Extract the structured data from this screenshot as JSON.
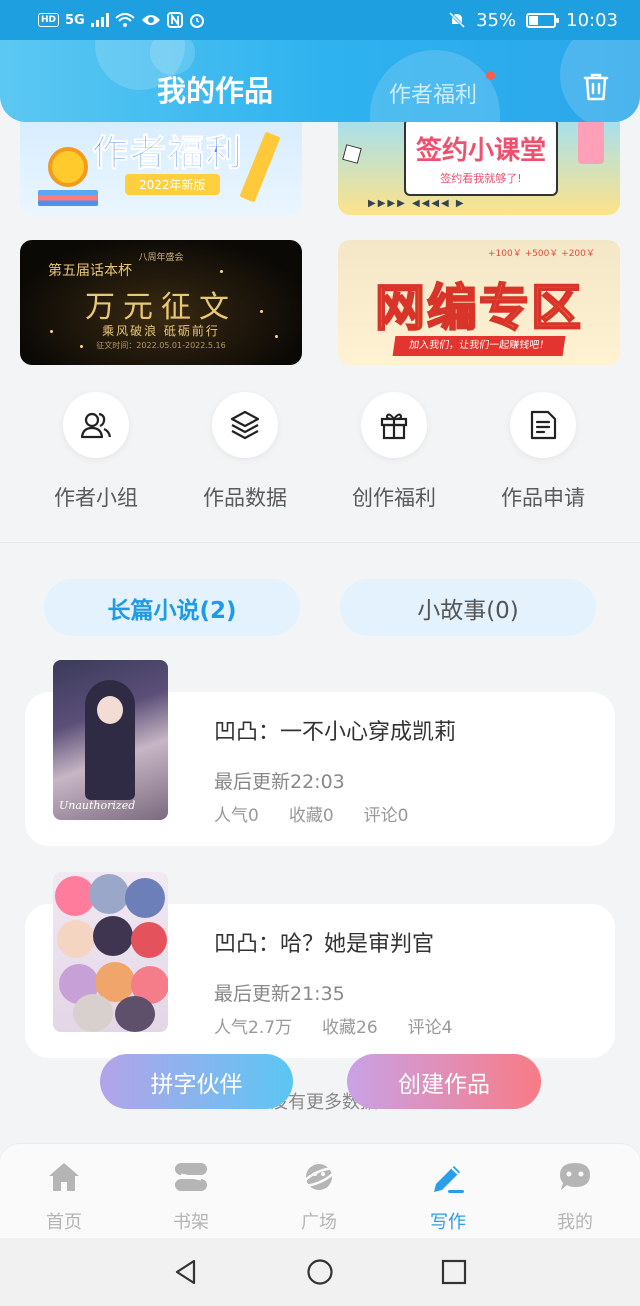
{
  "status_bar": {
    "left_icons": [
      "HD",
      "5G"
    ],
    "battery_percent": "35%",
    "battery_level": 0.35,
    "time": "10:03"
  },
  "header": {
    "tab_active": "我的作品",
    "tab_inactive": "作者福利",
    "trash_icon": "trash-icon"
  },
  "banners": {
    "welfare": {
      "title": "作者福利",
      "subtitle": "2022年新版"
    },
    "class": {
      "title": "签约小课堂",
      "subtitle": "签约看我就够了!"
    },
    "contest": {
      "top": "八周年盛会",
      "left": "第五届话本杯",
      "title": "万元征文",
      "subtitle": "乘风破浪 砥砺前行",
      "date": "征文时间：2022.05.01-2022.5.16"
    },
    "zone": {
      "money": "+100￥   +500￥   +200￥",
      "title": "网编专区",
      "ribbon": "加入我们，让我们一起赚钱吧！"
    }
  },
  "quick_actions": [
    {
      "label": "作者小组",
      "icon": "people-icon"
    },
    {
      "label": "作品数据",
      "icon": "layers-icon"
    },
    {
      "label": "创作福利",
      "icon": "gift-icon"
    },
    {
      "label": "作品申请",
      "icon": "document-icon"
    }
  ],
  "tabs": {
    "long": "长篇小说(2)",
    "short": "小故事(0)"
  },
  "works": [
    {
      "title": "凹凸：一不小心穿成凯莉",
      "update": "最后更新22:03",
      "popularity": "人气0",
      "favorites": "收藏0",
      "comments": "评论0",
      "cover_text": "Unauthorized"
    },
    {
      "title": "凹凸：哈？她是审判官",
      "update": "最后更新21:35",
      "popularity": "人气2.7万",
      "favorites": "收藏26",
      "comments": "评论4"
    }
  ],
  "floating_buttons": {
    "partner": "拼字伙伴",
    "create": "创建作品"
  },
  "no_more_text": "没有更多数据",
  "bottom_nav": [
    {
      "label": "首页",
      "icon": "home-icon",
      "active": false
    },
    {
      "label": "书架",
      "icon": "bookshelf-icon",
      "active": false
    },
    {
      "label": "广场",
      "icon": "planet-icon",
      "active": false
    },
    {
      "label": "写作",
      "icon": "pen-icon",
      "active": true
    },
    {
      "label": "我的",
      "icon": "chat-icon",
      "active": false
    }
  ],
  "colors": {
    "accent": "#2a9ee9",
    "header_blue": "#2fb3ef",
    "create_pink": "#f87b86"
  }
}
